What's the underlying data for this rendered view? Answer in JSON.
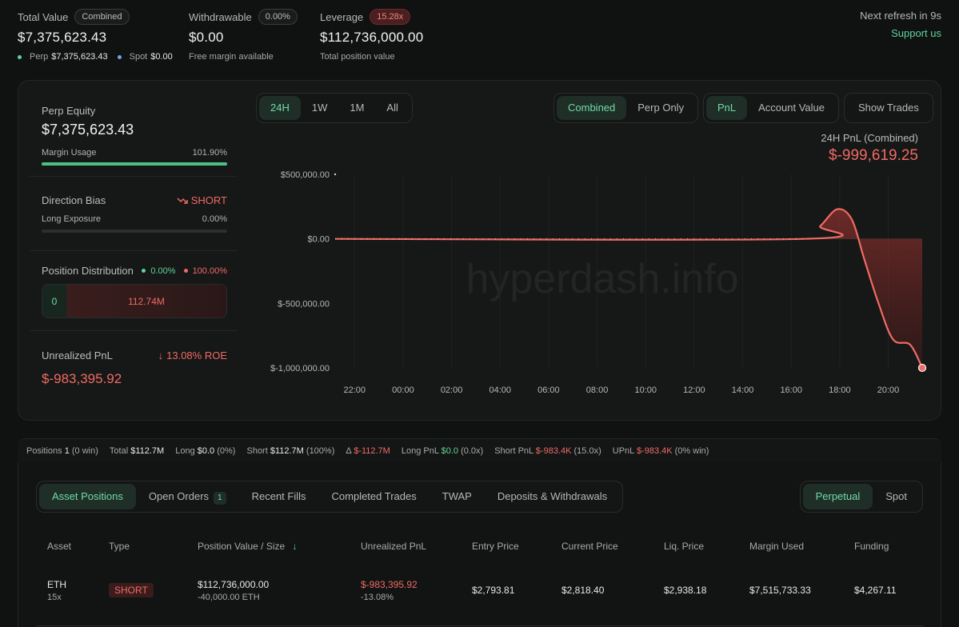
{
  "top": {
    "total_value": {
      "label": "Total Value",
      "badge": "Combined",
      "value": "$7,375,623.43",
      "perp_label": "Perp",
      "perp_value": "$7,375,623.43",
      "spot_label": "Spot",
      "spot_value": "$0.00"
    },
    "withdrawable": {
      "label": "Withdrawable",
      "badge": "0.00%",
      "value": "$0.00",
      "sub": "Free margin available"
    },
    "leverage": {
      "label": "Leverage",
      "badge": "15.28x",
      "value": "$112,736,000.00",
      "sub": "Total position value"
    },
    "refresh": "Next refresh in 9s",
    "support": "Support us"
  },
  "left_panel": {
    "perp_equity": {
      "label": "Perp Equity",
      "value": "$7,375,623.43",
      "margin_label": "Margin Usage",
      "margin_value": "101.90%",
      "margin_fraction": 1.0
    },
    "direction": {
      "label": "Direction Bias",
      "value": "SHORT",
      "exposure_label": "Long Exposure",
      "exposure_value": "0.00%",
      "exposure_fraction": 0.0
    },
    "distribution": {
      "label": "Position Distribution",
      "long_pct": "0.00%",
      "short_pct": "100.00%",
      "long_value": "0",
      "short_value": "112.74M"
    },
    "upnl": {
      "label": "Unrealized PnL",
      "roe": "13.08% ROE",
      "value": "$-983,395.92"
    }
  },
  "controls": {
    "ranges": [
      "24H",
      "1W",
      "1M",
      "All"
    ],
    "active_range": "24H",
    "scopes": [
      "Combined",
      "Perp Only"
    ],
    "metrics": [
      "PnL",
      "Account Value"
    ],
    "show_trades": "Show Trades"
  },
  "chart_header": {
    "label": "24H PnL (Combined)",
    "value": "$-999,619.25"
  },
  "watermark": "hyperdash.info",
  "chart_data": {
    "type": "area",
    "title": "24H PnL (Combined)",
    "x_ticks": [
      "22:00",
      "00:00",
      "02:00",
      "04:00",
      "06:00",
      "08:00",
      "10:00",
      "12:00",
      "14:00",
      "16:00",
      "18:00",
      "20:00"
    ],
    "y_ticks": [
      "$500,000.00",
      "$0.00",
      "$-500,000.00",
      "$-1,000,000.00"
    ],
    "ylim": [
      -1000000,
      500000
    ],
    "grid": true,
    "x_hours": [
      -2.8,
      16.5,
      17.2,
      17.9,
      18.5,
      19.0,
      19.6,
      20.2,
      20.9,
      21.4
    ],
    "values": [
      0,
      0,
      100000,
      230000,
      150000,
      -150000,
      -500000,
      -780000,
      -820000,
      -999619.25
    ]
  },
  "summary": {
    "positions_label": "Positions",
    "positions_value": "1",
    "positions_note": "(0 win)",
    "total_label": "Total",
    "total_value": "$112.7M",
    "long_label": "Long",
    "long_value": "$0.0",
    "long_note": "(0%)",
    "short_label": "Short",
    "short_value": "$112.7M",
    "short_note": "(100%)",
    "delta_label": "Δ",
    "delta_value": "$-112.7M",
    "longpnl_label": "Long PnL",
    "longpnl_value": "$0.0",
    "longpnl_note": "(0.0x)",
    "shortpnl_label": "Short PnL",
    "shortpnl_value": "$-983.4K",
    "shortpnl_note": "(15.0x)",
    "upnl_label": "UPnL",
    "upnl_value": "$-983.4K",
    "upnl_note": "(0% win)"
  },
  "tabs": {
    "items": [
      "Asset Positions",
      "Open Orders",
      "Recent Fills",
      "Completed Trades",
      "TWAP",
      "Deposits & Withdrawals"
    ],
    "open_orders_count": "1",
    "market": [
      "Perpetual",
      "Spot"
    ]
  },
  "table": {
    "headers": [
      "Asset",
      "Type",
      "Position Value / Size",
      "Unrealized PnL",
      "Entry Price",
      "Current Price",
      "Liq. Price",
      "Margin Used",
      "Funding"
    ],
    "row": {
      "asset": "ETH",
      "leverage": "15x",
      "type": "SHORT",
      "value": "$112,736,000.00",
      "size": "-40,000.00 ETH",
      "upnl": "$-983,395.92",
      "upnl_pct": "-13.08%",
      "entry": "$2,793.81",
      "current": "$2,818.40",
      "liq": "$2,938.18",
      "margin": "$7,515,733.33",
      "funding": "$4,267.11"
    }
  },
  "colors": {
    "accent": "#5fd39b",
    "negative": "#ef6b64",
    "background": "#101111"
  }
}
